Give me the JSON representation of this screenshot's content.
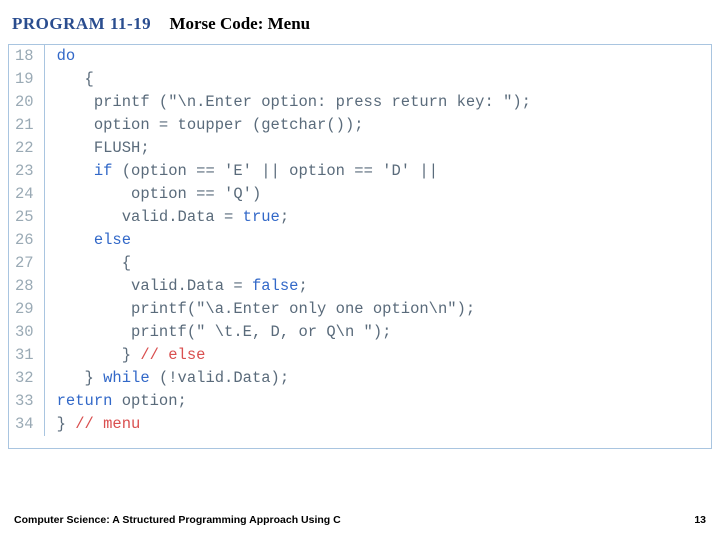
{
  "header": {
    "program_label": "PROGRAM 11-19",
    "title": "Morse Code: Menu"
  },
  "footer": {
    "book_title": "Computer Science: A Structured Programming Approach Using C",
    "page": "13"
  },
  "code": {
    "first_line": 18,
    "lines": [
      {
        "n": "18",
        "seg": [
          {
            "c": "kw",
            "t": "do"
          }
        ]
      },
      {
        "n": "19",
        "seg": [
          {
            "c": "",
            "t": "   {"
          }
        ]
      },
      {
        "n": "20",
        "seg": [
          {
            "c": "",
            "t": "    printf (\"\\n.Enter option: press return key: \");"
          }
        ]
      },
      {
        "n": "21",
        "seg": [
          {
            "c": "",
            "t": "    option = toupper (getchar());"
          }
        ]
      },
      {
        "n": "22",
        "seg": [
          {
            "c": "",
            "t": "    FLUSH;"
          }
        ]
      },
      {
        "n": "23",
        "seg": [
          {
            "c": "",
            "t": "    "
          },
          {
            "c": "kw",
            "t": "if"
          },
          {
            "c": "",
            "t": " (option == 'E' || option == 'D' ||"
          }
        ]
      },
      {
        "n": "24",
        "seg": [
          {
            "c": "",
            "t": "        option == 'Q')"
          }
        ]
      },
      {
        "n": "25",
        "seg": [
          {
            "c": "",
            "t": "       valid.Data = "
          },
          {
            "c": "kw",
            "t": "true"
          },
          {
            "c": "",
            "t": ";"
          }
        ]
      },
      {
        "n": "26",
        "seg": [
          {
            "c": "",
            "t": "    "
          },
          {
            "c": "kw",
            "t": "else"
          }
        ]
      },
      {
        "n": "27",
        "seg": [
          {
            "c": "",
            "t": "       {"
          }
        ]
      },
      {
        "n": "28",
        "seg": [
          {
            "c": "",
            "t": "        valid.Data = "
          },
          {
            "c": "kw",
            "t": "false"
          },
          {
            "c": "",
            "t": ";"
          }
        ]
      },
      {
        "n": "29",
        "seg": [
          {
            "c": "",
            "t": "        printf(\"\\a.Enter only one option\\n\");"
          }
        ]
      },
      {
        "n": "30",
        "seg": [
          {
            "c": "",
            "t": "        printf(\" \\t.E, D, or Q\\n \");"
          }
        ]
      },
      {
        "n": "31",
        "seg": [
          {
            "c": "",
            "t": "       } "
          },
          {
            "c": "cm",
            "t": "// else"
          }
        ]
      },
      {
        "n": "32",
        "seg": [
          {
            "c": "",
            "t": "   } "
          },
          {
            "c": "kw",
            "t": "while"
          },
          {
            "c": "",
            "t": " (!valid.Data);"
          }
        ]
      },
      {
        "n": "33",
        "seg": [
          {
            "c": "kw",
            "t": "return"
          },
          {
            "c": "",
            "t": " option;"
          }
        ]
      },
      {
        "n": "34",
        "seg": [
          {
            "c": "",
            "t": "} "
          },
          {
            "c": "cm",
            "t": "// menu"
          }
        ]
      }
    ]
  }
}
